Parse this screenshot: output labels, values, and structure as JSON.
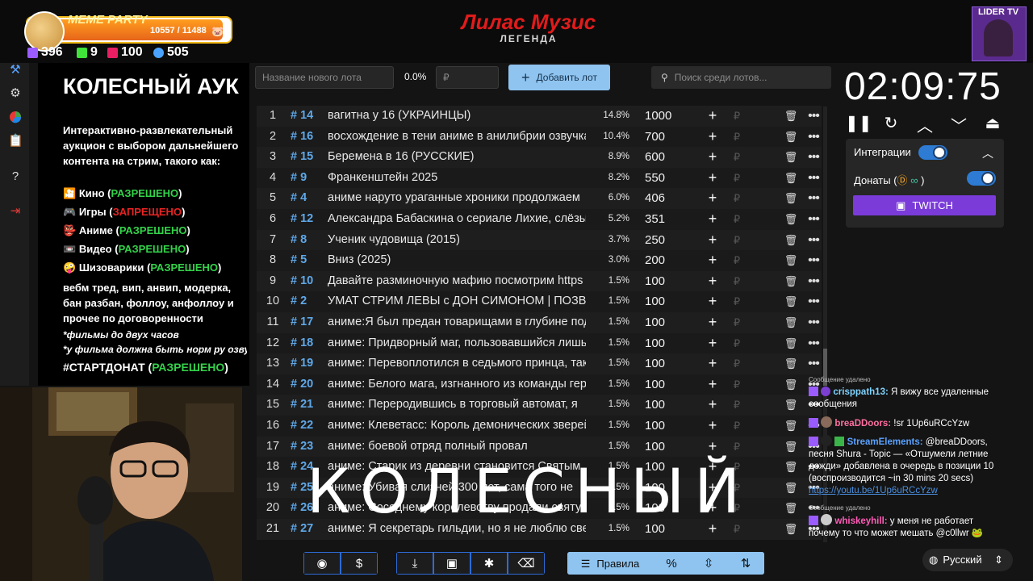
{
  "stream_header": {
    "meme_party_title": "MEME PARTY",
    "meme_party_count": "10557 / 11488",
    "stats": [
      {
        "icon": "twitch-icon",
        "value": "396",
        "color": "#9b5cff"
      },
      {
        "icon": "kick-icon",
        "value": "9",
        "color": "#3fe33a"
      },
      {
        "icon": "live-icon",
        "value": "100",
        "color": "#e91e63"
      },
      {
        "icon": "viewers-icon",
        "value": "505",
        "color": "#4aa3ff"
      }
    ],
    "title": "Лилас Музис",
    "subtitle": "ЛЕГЕНДА",
    "channel_badge": "LIDER TV"
  },
  "rules": {
    "heading": "КОЛЕСНЫЙ АУК",
    "intro": "Интерактивно-развлекательный аукцион с выбором дальнейшего контента на стрим, такого как:",
    "categories": [
      {
        "emoji": "🎦",
        "label": "Кино",
        "open": "(",
        "status": "РАЗРЕШЕНО",
        "close": ")"
      },
      {
        "emoji": "🎮",
        "label": "Игры",
        "open": "(",
        "status": "ЗАПРЕЩЕНО",
        "close": ")"
      },
      {
        "emoji": "👺",
        "label": "Аниме",
        "open": "(",
        "status": "РАЗРЕШЕНО",
        "close": ")"
      },
      {
        "emoji": "📼",
        "label": "Видео",
        "open": "(",
        "status": "РАЗРЕШЕНО",
        "close": ")"
      },
      {
        "emoji": "🤪",
        "label": "Шизоварики",
        "open": "(",
        "status": "РАЗРЕШЕНО",
        "close": ")"
      }
    ],
    "extra": "вебм тред, вип, анвип, модерка, бан разбан, фоллоу, анфоллоу и прочее по договоренности",
    "note1": "*фильмы до двух часов",
    "note2": "*у фильма должна быть норм ру озвуч",
    "startdonat_label": "#СТАРТДОНАТ",
    "startdonat_open": "(",
    "startdonat_status": "РАЗРЕШЕНО",
    "startdonat_close": ")"
  },
  "toolbar": {
    "lot_name_placeholder": "Название нового лота",
    "percent": "0.0%",
    "amount_placeholder": "₽",
    "add_lot_label": "Добавить лот",
    "search_placeholder": "Поиск среди лотов..."
  },
  "lots": [
    {
      "n": "1",
      "id": "# 14",
      "name": "вагитна у 16 (УКРАИНЦЫ)",
      "pct": "14.8%",
      "amount": "1000"
    },
    {
      "n": "2",
      "id": "# 16",
      "name": "восхождение в тени аниме в анилибрии озвучка",
      "pct": "10.4%",
      "amount": "700"
    },
    {
      "n": "3",
      "id": "# 15",
      "name": "Беремена в 16 (РУССКИЕ)",
      "pct": "8.9%",
      "amount": "600"
    },
    {
      "n": "4",
      "id": "# 9",
      "name": "Франкенштейн 2025",
      "pct": "8.2%",
      "amount": "550"
    },
    {
      "n": "5",
      "id": "# 4",
      "name": "аниме наруто ураганные хроники продолжаем",
      "pct": "6.0%",
      "amount": "406"
    },
    {
      "n": "6",
      "id": "# 12",
      "name": "Александра Бабаскина о сериале Лихие, слёзы",
      "pct": "5.2%",
      "amount": "351"
    },
    {
      "n": "7",
      "id": "# 8",
      "name": "Ученик чудовища (2015)",
      "pct": "3.7%",
      "amount": "250"
    },
    {
      "n": "8",
      "id": "# 5",
      "name": "Вниз (2025)",
      "pct": "3.0%",
      "amount": "200"
    },
    {
      "n": "9",
      "id": "# 10",
      "name": "Давайте разминочную мафию посмотрим https",
      "pct": "1.5%",
      "amount": "100"
    },
    {
      "n": "10",
      "id": "# 2",
      "name": "УМАТ СТРИМ ЛЕВЫ с ДОН СИМОНОМ | ПОЗВОНИ",
      "pct": "1.5%",
      "amount": "100"
    },
    {
      "n": "11",
      "id": "# 17",
      "name": "аниме:Я был предан товарищами в глубине подземелья",
      "pct": "1.5%",
      "amount": "100"
    },
    {
      "n": "12",
      "id": "# 18",
      "name": "аниме: Придворный маг, пользовавшийся лишь",
      "pct": "1.5%",
      "amount": "100"
    },
    {
      "n": "13",
      "id": "# 19",
      "name": "аниме: Перевоплотился в седьмого принца, так",
      "pct": "1.5%",
      "amount": "100"
    },
    {
      "n": "14",
      "id": "# 20",
      "name": "аниме: Белого мага, изгнанного из команды героя",
      "pct": "1.5%",
      "amount": "100"
    },
    {
      "n": "15",
      "id": "# 21",
      "name": "аниме: Переродившись в торговый автомат, я",
      "pct": "1.5%",
      "amount": "100"
    },
    {
      "n": "16",
      "id": "# 22",
      "name": "аниме: Клеветасс: Король демонических зверей",
      "pct": "1.5%",
      "amount": "100"
    },
    {
      "n": "17",
      "id": "# 23",
      "name": "аниме: боевой отряд полный провал",
      "pct": "1.5%",
      "amount": "100"
    },
    {
      "n": "18",
      "id": "# 24",
      "name": "аниме: Старик из деревни становится Святым",
      "pct": "1.5%",
      "amount": "100"
    },
    {
      "n": "19",
      "id": "# 25",
      "name": "аниме: Убивая слизней 300 лет, сама того не",
      "pct": "1.5%",
      "amount": "100"
    },
    {
      "n": "20",
      "id": "# 26",
      "name": "аниме: Соседнему королевству продали святую",
      "pct": "1.5%",
      "amount": "100"
    },
    {
      "n": "21",
      "id": "# 27",
      "name": "аниме: Я секретарь гильдии, но я не люблю сверх",
      "pct": "1.5%",
      "amount": "100"
    }
  ],
  "overlay_text": "КОЛЕСНЫЙ",
  "bottom_toolbar": {
    "rules_label": "Правила",
    "percent_symbol": "%"
  },
  "timer": {
    "value": "02:09:75"
  },
  "integrations": {
    "label": "Интеграции",
    "donations_label": "Донаты (",
    "donations_close": ")",
    "twitch_label": "TWITCH"
  },
  "chat": {
    "deleted_note": "Сообщение удалено",
    "messages": [
      {
        "user": "crisppath13:",
        "user_color": "#7fd3ff",
        "text": "Я вижу все удаленные сообщения"
      },
      {
        "user": "breaDDoors:",
        "user_color": "#ff6fa0",
        "text": "!sr 1Up6uRCcYzw"
      },
      {
        "user": "StreamElements:",
        "user_color": "#5aa2ff",
        "text": "@breaDDoors, песня Shura - Topic — «Отшумели летние дожди» добавлена в очередь в позиции 10 (воспроизводится ~in 30 mins 20 secs)",
        "link": "https://youtu.be/1Up6uRCcYzw"
      },
      {
        "user": "whiskeyhill:",
        "user_color": "#ff5cb8",
        "text": "у меня не работает почему то что может мешать @c0llwr"
      }
    ]
  },
  "language": "Русский"
}
